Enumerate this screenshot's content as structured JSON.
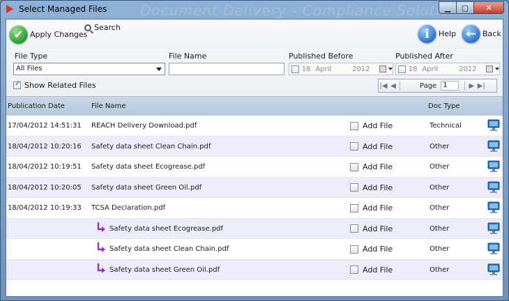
{
  "window": {
    "title": "Select Managed Files",
    "watermark": "Document Delivery - Compliance Solutions"
  },
  "toolbar": {
    "apply_label": "Apply Changes",
    "search_label": "Search",
    "help_label": "Help",
    "back_label": "Back"
  },
  "filters": {
    "file_type_label": "File Type",
    "file_type_value": "All Files",
    "file_name_label": "File Name",
    "file_name_value": "",
    "published_before_label": "Published Before",
    "published_before": {
      "day": "18",
      "month": "April",
      "year": "2012",
      "checked": false
    },
    "published_after_label": "Published After",
    "published_after": {
      "day": "18",
      "month": "April",
      "year": "2012",
      "checked": false
    },
    "show_related_label": "Show Related Files",
    "show_related_checked": true
  },
  "pager": {
    "page_label": "Page",
    "page_value": "1"
  },
  "grid": {
    "headers": {
      "date": "Publication Date",
      "name": "File Name",
      "type": "Doc Type"
    },
    "add_file_label": "Add File",
    "rows": [
      {
        "date": "17/04/2012 14:51:31",
        "name": "REACH Delivery Download.pdf",
        "type": "Technical",
        "child": false,
        "checked": false
      },
      {
        "date": "18/04/2012 10:20:16",
        "name": "Safety data sheet Clean Chain.pdf",
        "type": "Other",
        "child": false,
        "checked": false
      },
      {
        "date": "18/04/2012 10:19:51",
        "name": "Safety data sheet Ecogrease.pdf",
        "type": "Other",
        "child": false,
        "checked": false
      },
      {
        "date": "18/04/2012 10:20:05",
        "name": "Safety data sheet Green Oil.pdf",
        "type": "Other",
        "child": false,
        "checked": false
      },
      {
        "date": "18/04/2012 10:19:33",
        "name": "TCSA Declaration.pdf",
        "type": "Other",
        "child": false,
        "checked": false
      },
      {
        "date": "",
        "name": "Safety data sheet Ecogrease.pdf",
        "type": "Other",
        "child": true,
        "checked": false
      },
      {
        "date": "",
        "name": "Safety data sheet Clean Chain.pdf",
        "type": "Other",
        "child": true,
        "checked": false
      },
      {
        "date": "",
        "name": "Safety data sheet Green Oil.pdf",
        "type": "Other",
        "child": true,
        "checked": false
      }
    ]
  },
  "icons": {
    "apply": "checkmark-icon",
    "search": "search-icon",
    "help": "info-icon",
    "back": "back-arrow-icon",
    "row_action": "monitor-icon",
    "child": "child-arrow-icon"
  },
  "colors": {
    "header_bg": "#c3d1e4",
    "alt_row_bg": "#ecedf8",
    "child_arrow": "#9b2fbf"
  }
}
